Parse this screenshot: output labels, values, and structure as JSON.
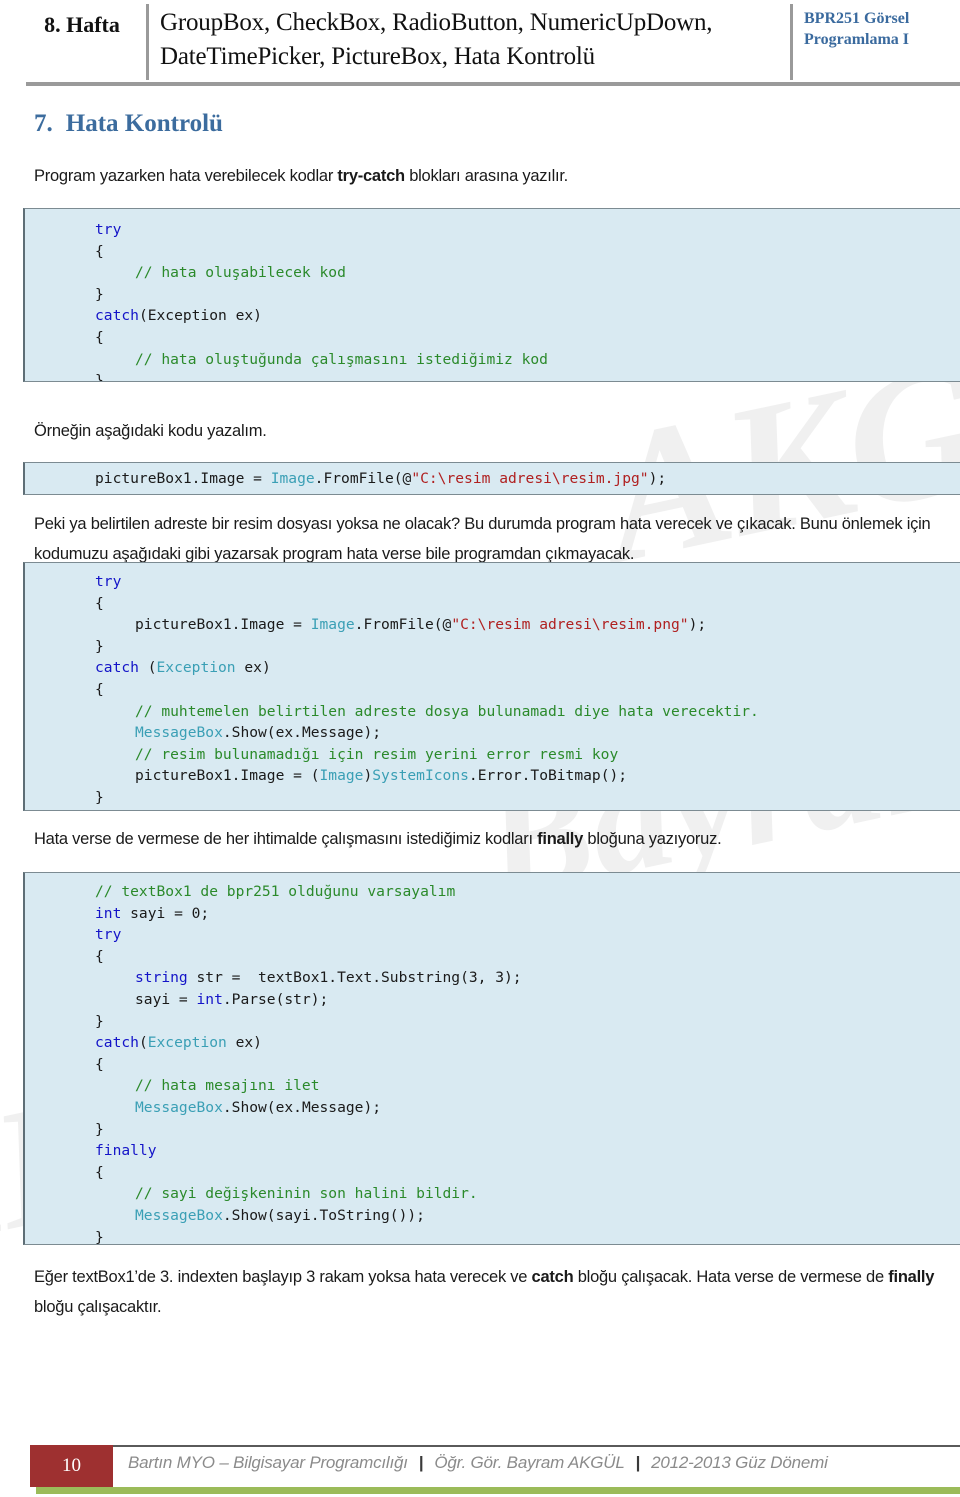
{
  "header": {
    "week": "8. Hafta",
    "title": "GroupBox, CheckBox, RadioButton, NumericUpDown, DateTimePicker, PictureBox, Hata Kontrolü",
    "course_line1": "BPR251 Görsel",
    "course_line2": "Programlama I",
    "accent_color": "#3a6a9e"
  },
  "section": {
    "number": "7.",
    "heading": "Hata Kontrolü",
    "heading_color": "#3c6c9e"
  },
  "paragraphs": {
    "p1_a": "Program yazarken hata verebilecek kodlar ",
    "p1_b": "try-catch",
    "p1_c": " blokları arasına yazılır.",
    "p2": "Örneğin aşağıdaki kodu yazalım.",
    "p3_line1": "Peki ya belirtilen adreste bir resim dosyası yoksa ne olacak? Bu durumda program hata verecek ve çıkacak.",
    "p3_line2": "Bunu önlemek için kodumuzu aşağıdaki gibi yazarsak program hata verse bile programdan çıkmayacak.",
    "p4_a": "Hata verse de vermese de her ihtimalde çalışmasını istediğimiz kodları ",
    "p4_b": "finally",
    "p4_c": " bloğuna yazıyoruz.",
    "p5_a": "Eğer textBox1’de 3. indexten başlayıp 3 rakam yoksa hata verecek ve ",
    "p5_b": "catch",
    "p5_c": " bloğu çalışacak. Hata verse de vermese de ",
    "p5_d": "finally",
    "p5_e": " bloğu çalışacaktır."
  },
  "code_blocks": {
    "block1": {
      "lines": [
        [
          [
            "kw",
            "try"
          ]
        ],
        [
          [
            "pl",
            "{"
          ]
        ],
        [
          [
            "ind",
            ""
          ],
          [
            "cm",
            "// hata oluşabilecek kod"
          ]
        ],
        [
          [
            "pl",
            "}"
          ]
        ],
        [
          [
            "kw",
            "catch"
          ],
          [
            "pl",
            "(Exception ex)"
          ]
        ],
        [
          [
            "pl",
            "{"
          ]
        ],
        [
          [
            "ind",
            ""
          ],
          [
            "cm",
            "// hata oluştuğunda çalışmasını istediğimiz kod"
          ]
        ],
        [
          [
            "pl",
            "}"
          ]
        ]
      ]
    },
    "block2": {
      "lines": [
        [
          [
            "pl",
            "pictureBox1.Image = "
          ],
          [
            "ty",
            "Image"
          ],
          [
            "pl",
            ".FromFile(@"
          ],
          [
            "st",
            "\"C:\\resim adresi\\resim.jpg\""
          ],
          [
            "pl",
            ");"
          ]
        ]
      ]
    },
    "block3": {
      "lines": [
        [
          [
            "kw",
            "try"
          ]
        ],
        [
          [
            "pl",
            "{"
          ]
        ],
        [
          [
            "ind",
            ""
          ],
          [
            "pl",
            "pictureBox1.Image = "
          ],
          [
            "ty",
            "Image"
          ],
          [
            "pl",
            ".FromFile(@"
          ],
          [
            "st",
            "\"C:\\resim adresi\\resim.png\""
          ],
          [
            "pl",
            ");"
          ]
        ],
        [
          [
            "pl",
            "}"
          ]
        ],
        [
          [
            "kw",
            "catch"
          ],
          [
            "pl",
            " ("
          ],
          [
            "ty",
            "Exception"
          ],
          [
            "pl",
            " ex)"
          ]
        ],
        [
          [
            "pl",
            "{"
          ]
        ],
        [
          [
            "ind",
            ""
          ],
          [
            "cm",
            "// muhtemelen belirtilen adreste dosya bulunamadı diye hata verecektir."
          ]
        ],
        [
          [
            "ind",
            ""
          ],
          [
            "ty",
            "MessageBox"
          ],
          [
            "pl",
            ".Show(ex.Message);"
          ]
        ],
        [
          [
            "ind",
            ""
          ],
          [
            "cm",
            "// resim bulunamadığı için resim yerini error resmi koy"
          ]
        ],
        [
          [
            "ind",
            ""
          ],
          [
            "pl",
            "pictureBox1.Image = ("
          ],
          [
            "ty",
            "Image"
          ],
          [
            "pl",
            ")"
          ],
          [
            "ty",
            "SystemIcons"
          ],
          [
            "pl",
            ".Error.ToBitmap();"
          ]
        ],
        [
          [
            "pl",
            "}"
          ]
        ]
      ]
    },
    "block4": {
      "lines": [
        [
          [
            "cm",
            "// textBox1 de bpr251 olduğunu varsayalım"
          ]
        ],
        [
          [
            "kw",
            "int"
          ],
          [
            "pl",
            " sayi = 0;"
          ]
        ],
        [
          [
            "kw",
            "try"
          ]
        ],
        [
          [
            "pl",
            "{"
          ]
        ],
        [
          [
            "ind",
            ""
          ],
          [
            "kw",
            "string"
          ],
          [
            "pl",
            " str =  textBox1.Text.Substring(3, 3);"
          ]
        ],
        [
          [
            "ind",
            ""
          ],
          [
            "pl",
            "sayi = "
          ],
          [
            "kw",
            "int"
          ],
          [
            "pl",
            ".Parse(str);"
          ]
        ],
        [
          [
            "pl",
            "}"
          ]
        ],
        [
          [
            "kw",
            "catch"
          ],
          [
            "pl",
            "("
          ],
          [
            "ty",
            "Exception"
          ],
          [
            "pl",
            " ex)"
          ]
        ],
        [
          [
            "pl",
            "{"
          ]
        ],
        [
          [
            "ind",
            ""
          ],
          [
            "cm",
            "// hata mesajını ilet"
          ]
        ],
        [
          [
            "ind",
            ""
          ],
          [
            "ty",
            "MessageBox"
          ],
          [
            "pl",
            ".Show(ex.Message);"
          ]
        ],
        [
          [
            "pl",
            "}"
          ]
        ],
        [
          [
            "kw",
            "finally"
          ]
        ],
        [
          [
            "pl",
            "{"
          ]
        ],
        [
          [
            "ind",
            ""
          ],
          [
            "cm",
            "// sayi değişkeninin son halini bildir."
          ]
        ],
        [
          [
            "ind",
            ""
          ],
          [
            "ty",
            "MessageBox"
          ],
          [
            "pl",
            ".Show(sayi.ToString());"
          ]
        ],
        [
          [
            "pl",
            "}"
          ]
        ]
      ]
    },
    "colors": {
      "background": "#d9eaf2",
      "keyword": "#1414c8",
      "comment": "#2b8a2b",
      "type": "#3a9fb5",
      "string": "#b02020"
    }
  },
  "footer": {
    "page_number": "10",
    "institution": "Bartın MYO – Bilgisayar Programcılığı",
    "instructor": "Öğr. Gör. Bayram AKGÜL",
    "term": "2012-2013 Güz Dönemi",
    "separator": "|",
    "page_box_color": "#9e3030",
    "accent_bar_color": "#9bbb59"
  },
  "watermark": {
    "text": "AKGÜL",
    "text2": "Bayram"
  }
}
